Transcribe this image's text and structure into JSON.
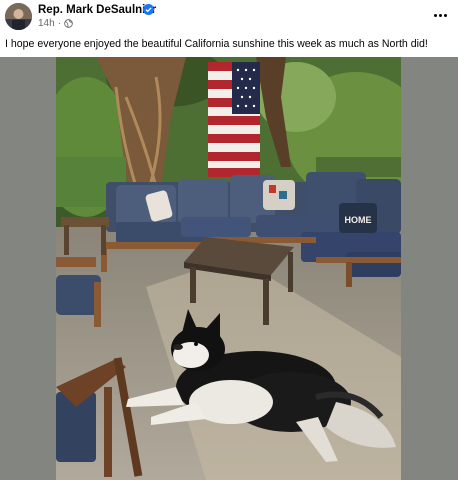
{
  "post": {
    "author": "Rep. Mark DeSaulnier",
    "time": "14h",
    "caption": "I hope everyone enjoyed the beautiful California sunshine this week as much as North did!",
    "pillow_text": "HOME"
  },
  "icons": {
    "verified": "verified-badge-icon",
    "audience": "globe-icon",
    "more": "more-options-icon"
  },
  "colors": {
    "verified": "#1877f2",
    "meta_text": "#65676b",
    "letterbox": "#838581"
  }
}
